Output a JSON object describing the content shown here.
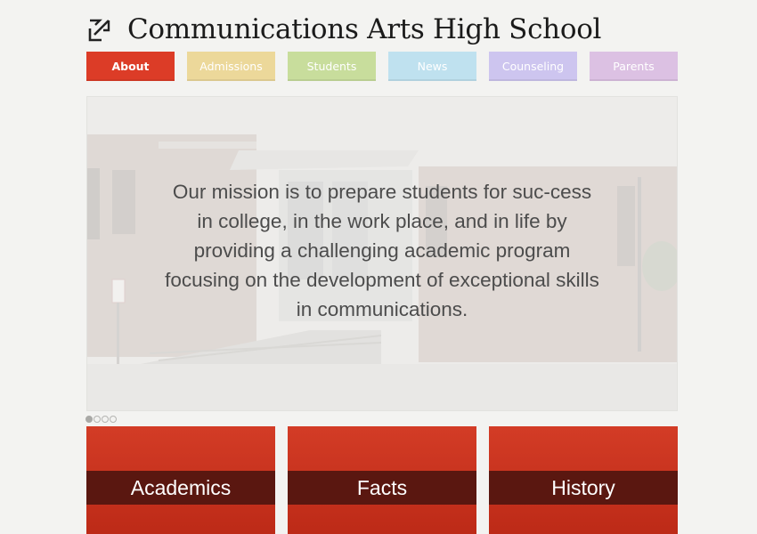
{
  "site": {
    "title": "Communications Arts High School",
    "logo_icon": "arrow-in-box-icon"
  },
  "nav": {
    "items": [
      {
        "label": "About",
        "color": "#dc3c27",
        "active": true
      },
      {
        "label": "Admissions",
        "color": "#ecd89a",
        "active": false
      },
      {
        "label": "Students",
        "color": "#c8dd9c",
        "active": false
      },
      {
        "label": "News",
        "color": "#bfe1ef",
        "active": false
      },
      {
        "label": "Counseling",
        "color": "#cdc5ef",
        "active": false
      },
      {
        "label": "Parents",
        "color": "#dcc1e3",
        "active": false
      }
    ]
  },
  "hero": {
    "mission": "Our mission is to prepare students for suc-cess in college, in the work place, and in life by providing a challenging academic program focusing on the development of exceptional skills in communications.",
    "slides_count": 4,
    "active_slide": 1
  },
  "cards": [
    {
      "label": "Academics"
    },
    {
      "label": "Facts"
    },
    {
      "label": "History"
    }
  ],
  "colors": {
    "accent": "#dc3c27",
    "card_band": "#5a1710",
    "background": "#f3f3f1"
  }
}
